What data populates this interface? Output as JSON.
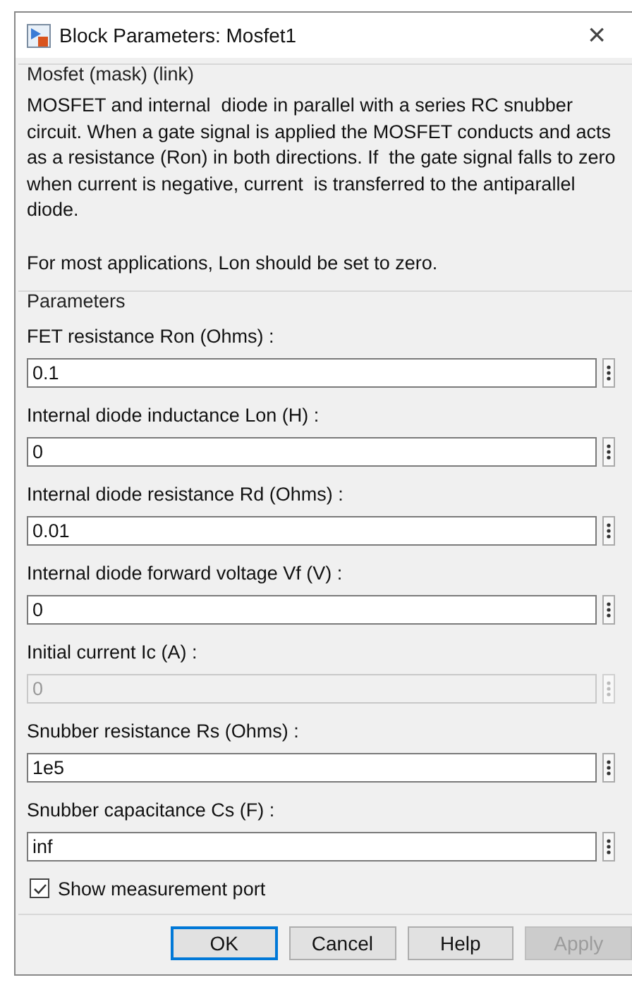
{
  "window": {
    "title": "Block Parameters: Mosfet1",
    "close": "×"
  },
  "mask": {
    "title": "Mosfet (mask) (link)",
    "description": "MOSFET and internal  diode in parallel with a series RC snubber circuit. When a gate signal is applied the MOSFET conducts and acts as a resistance (Ron) in both directions. If  the gate signal falls to zero when current is negative, current  is transferred to the antiparallel diode.",
    "note": "For most applications, Lon should be set to zero."
  },
  "parameters": {
    "title": "Parameters",
    "fields": [
      {
        "label": "FET resistance Ron (Ohms) :",
        "value": "0.1",
        "disabled": false
      },
      {
        "label": "Internal diode inductance Lon (H) :",
        "value": "0",
        "disabled": false
      },
      {
        "label": "Internal diode resistance Rd  (Ohms) :",
        "value": "0.01",
        "disabled": false
      },
      {
        "label": "Internal diode forward voltage Vf (V) :",
        "value": "0",
        "disabled": false
      },
      {
        "label": "Initial current Ic (A) :",
        "value": "0",
        "disabled": true
      },
      {
        "label": "Snubber resistance Rs (Ohms) :",
        "value": "1e5",
        "disabled": false
      },
      {
        "label": "Snubber capacitance Cs (F) :",
        "value": "inf",
        "disabled": false
      }
    ],
    "checkbox": {
      "label": "Show measurement port",
      "checked": true
    }
  },
  "buttons": [
    {
      "label": "OK",
      "default": true,
      "disabled": false
    },
    {
      "label": "Cancel",
      "default": false,
      "disabled": false
    },
    {
      "label": "Help",
      "default": false,
      "disabled": false
    },
    {
      "label": "Apply",
      "default": false,
      "disabled": true
    }
  ]
}
